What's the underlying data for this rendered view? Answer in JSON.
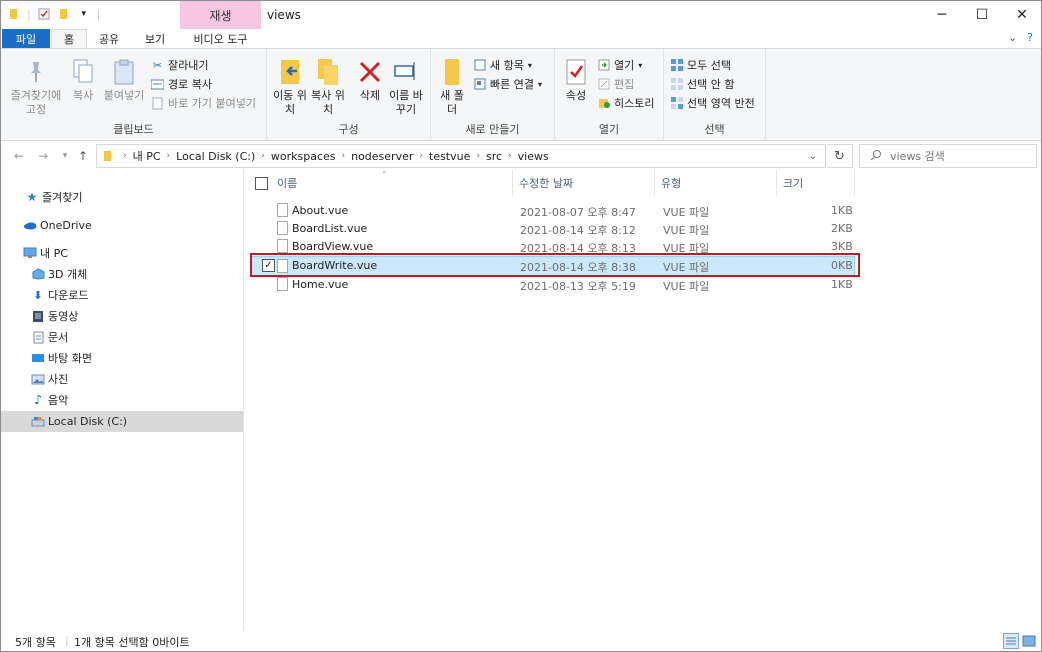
{
  "window": {
    "title": "views",
    "context_tab_header": "재생",
    "controls": {
      "minimize": "─",
      "maximize": "☐",
      "close": "✕"
    }
  },
  "ribbon_tabs": [
    {
      "label": "파일"
    },
    {
      "label": "홈"
    },
    {
      "label": "공유"
    },
    {
      "label": "보기"
    },
    {
      "label": "비디오 도구"
    }
  ],
  "ribbon": {
    "clipboard": {
      "label": "클립보드",
      "pin": "즐겨찾기에 고정",
      "copy": "복사",
      "paste": "붙여넣기",
      "cut": "잘라내기",
      "copy_path": "경로 복사",
      "paste_shortcut": "바로 가기 붙여넣기"
    },
    "organize": {
      "label": "구성",
      "move_to": "이동 위치",
      "copy_to": "복사 위치",
      "delete": "삭제",
      "rename": "이름 바꾸기"
    },
    "new": {
      "label": "새로 만들기",
      "new_folder": "새 폴더",
      "new_item": "새 항목",
      "easy_access": "빠른 연결"
    },
    "open": {
      "label": "열기",
      "properties": "속성",
      "open": "열기",
      "edit": "편집",
      "history": "히스토리"
    },
    "select": {
      "label": "선택",
      "select_all": "모두 선택",
      "select_none": "선택 안 함",
      "invert": "선택 영역 반전"
    }
  },
  "address": {
    "breadcrumb": [
      "내 PC",
      "Local Disk (C:)",
      "workspaces",
      "nodeserver",
      "testvue",
      "src",
      "views"
    ],
    "search_placeholder": "views 검색"
  },
  "nav_pane": {
    "items": [
      {
        "label": "즐겨찾기",
        "icon": "star-icon"
      },
      {
        "label": "OneDrive",
        "icon": "cloud-icon"
      },
      {
        "label": "내 PC",
        "icon": "computer-icon"
      },
      {
        "label": "3D 개체",
        "icon": "cube-icon"
      },
      {
        "label": "다운로드",
        "icon": "download-icon"
      },
      {
        "label": "동영상",
        "icon": "video-icon"
      },
      {
        "label": "문서",
        "icon": "document-icon"
      },
      {
        "label": "바탕 화면",
        "icon": "desktop-icon"
      },
      {
        "label": "사진",
        "icon": "picture-icon"
      },
      {
        "label": "음악",
        "icon": "music-icon"
      },
      {
        "label": "Local Disk (C:)",
        "icon": "drive-icon"
      }
    ]
  },
  "file_list": {
    "columns": [
      "이름",
      "수정한 날짜",
      "유형",
      "크기"
    ],
    "rows": [
      {
        "name": "About.vue",
        "date": "2021-08-07 오후 8:47",
        "type": "VUE 파일",
        "size": "1KB"
      },
      {
        "name": "BoardList.vue",
        "date": "2021-08-14 오후 8:12",
        "type": "VUE 파일",
        "size": "2KB"
      },
      {
        "name": "BoardView.vue",
        "date": "2021-08-14 오후 8:13",
        "type": "VUE 파일",
        "size": "3KB"
      },
      {
        "name": "BoardWrite.vue",
        "date": "2021-08-14 오후 8:38",
        "type": "VUE 파일",
        "size": "0KB"
      },
      {
        "name": "Home.vue",
        "date": "2021-08-13 오후 5:19",
        "type": "VUE 파일",
        "size": "1KB"
      }
    ],
    "selected_index": 3
  },
  "status": {
    "item_count": "5개 항목",
    "selection": "1개 항목 선택함 0바이트"
  },
  "colors": {
    "file_tab": "#1a6ec7",
    "context_header": "#f7c6e0",
    "selection_bg": "#cce8ff",
    "highlight_border": "#b3202a"
  }
}
